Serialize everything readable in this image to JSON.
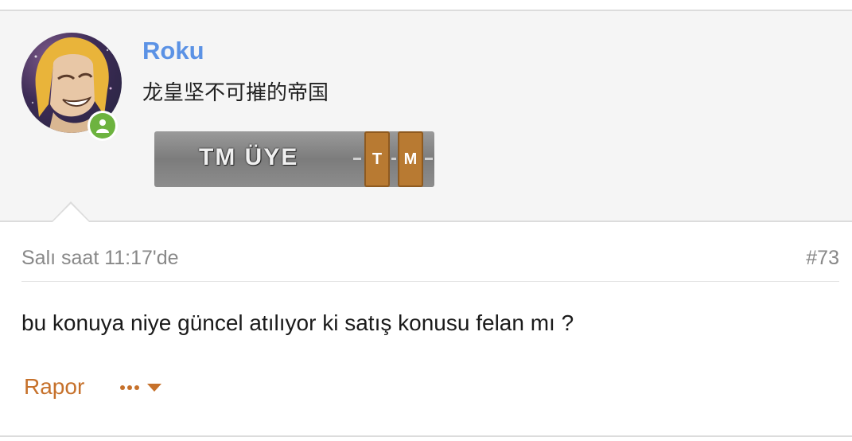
{
  "user": {
    "name": "Roku",
    "title": "龙皇坚不可摧的帝国",
    "rank_banner": {
      "text": "TM ÜYE",
      "tiles": [
        "T",
        "M"
      ]
    },
    "online_status_color": "#6db33f"
  },
  "post": {
    "date": "Salı saat 11:17'de",
    "number": "#73",
    "body": "bu konuya niye güncel atılıyor ki satış konusu felan mı ?"
  },
  "actions": {
    "report_label": "Rapor",
    "more_icon": "ellipsis-caret-icon"
  },
  "colors": {
    "username": "#5b92e5",
    "action": "#c6712b",
    "muted": "#888888"
  }
}
